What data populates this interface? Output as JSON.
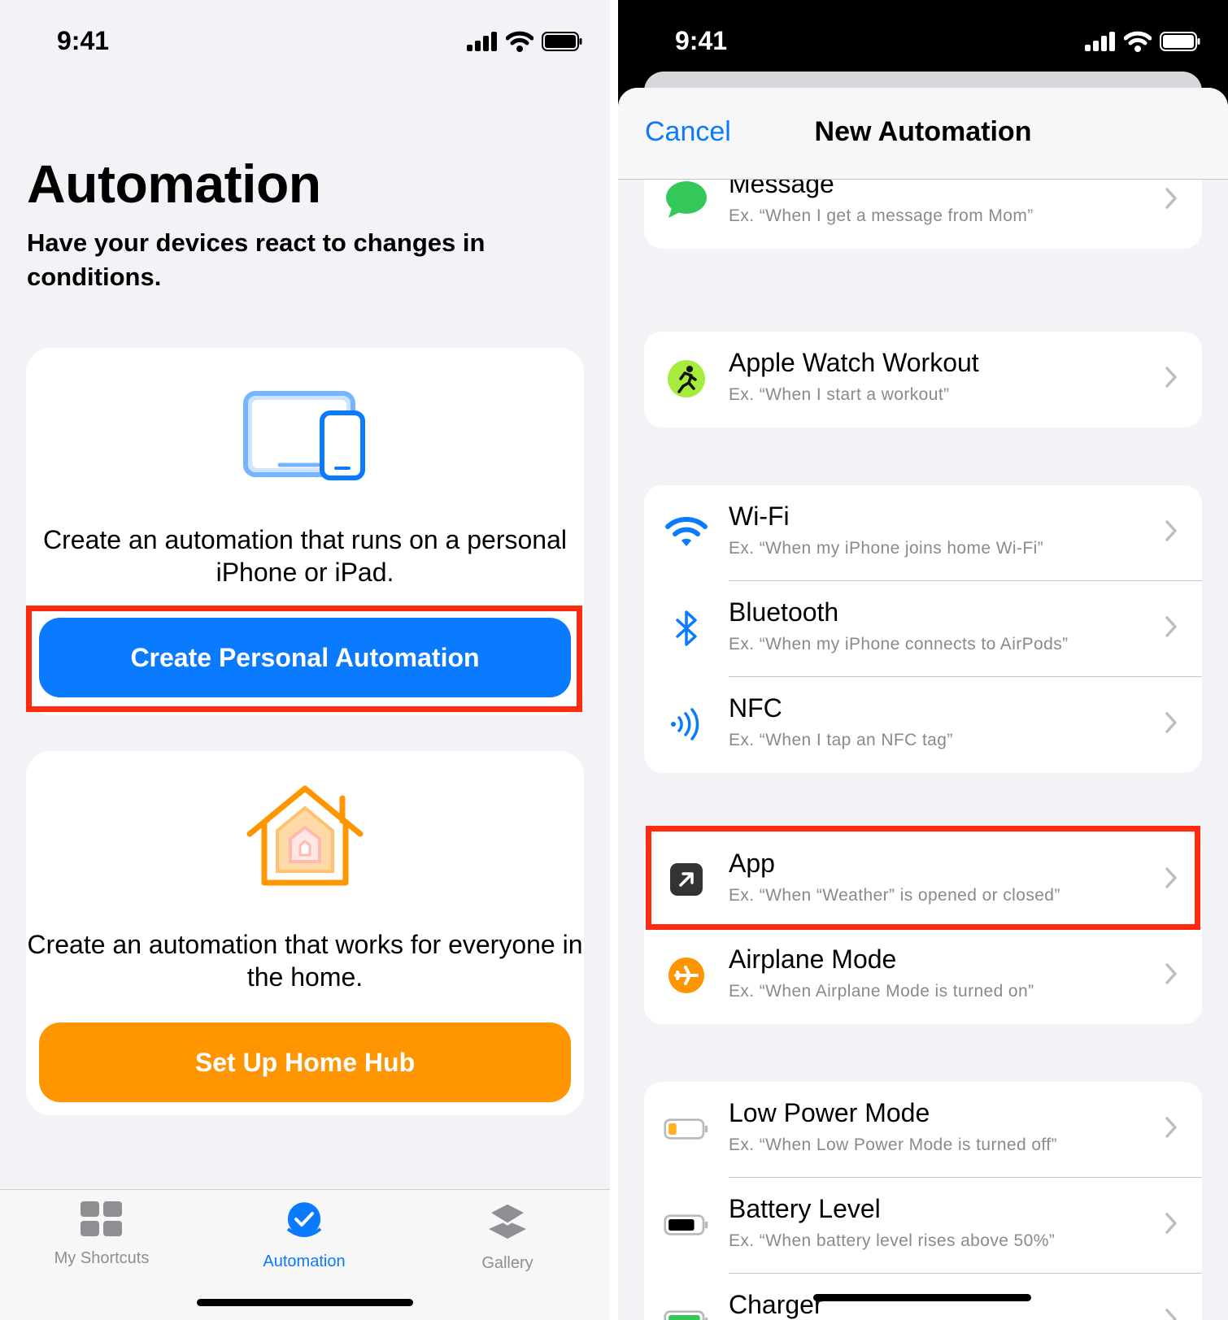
{
  "status_bar": {
    "time": "9:41"
  },
  "left": {
    "title": "Automation",
    "subtitle": "Have your devices react to changes in conditions.",
    "personal_card": {
      "icon": "devices-icon",
      "text": "Create an automation that runs on a personal iPhone or iPad.",
      "button_label": "Create Personal Automation",
      "button_color": "#0A7AFF"
    },
    "home_card": {
      "icon": "home-icon",
      "text": "Create an automation that works for everyone in the home.",
      "button_label": "Set Up Home Hub",
      "button_color": "#FF9500"
    },
    "tabs": [
      {
        "label": "My Shortcuts",
        "icon": "grid-icon",
        "active": false
      },
      {
        "label": "Automation",
        "icon": "checkmark-circle-icon",
        "active": true
      },
      {
        "label": "Gallery",
        "icon": "layers-icon",
        "active": false
      }
    ],
    "highlight_color": "#FF2A10"
  },
  "right": {
    "header": {
      "cancel_label": "Cancel",
      "title": "New Automation"
    },
    "groups": [
      {
        "rows": [
          {
            "title": "Message",
            "subtitle": "Ex. “When I get a message from Mom”",
            "icon": "message-bubble-icon"
          }
        ]
      },
      {
        "rows": [
          {
            "title": "Apple Watch Workout",
            "subtitle": "Ex. “When I start a workout”",
            "icon": "workout-runner-icon"
          }
        ]
      },
      {
        "rows": [
          {
            "title": "Wi-Fi",
            "subtitle": "Ex. “When my iPhone joins home Wi-Fi”",
            "icon": "wifi-icon"
          },
          {
            "title": "Bluetooth",
            "subtitle": "Ex. “When my iPhone connects to AirPods”",
            "icon": "bluetooth-icon"
          },
          {
            "title": "NFC",
            "subtitle": "Ex. “When I tap an NFC tag”",
            "icon": "nfc-icon"
          }
        ]
      },
      {
        "rows": [
          {
            "title": "App",
            "subtitle": "Ex. “When “Weather” is opened or closed”",
            "icon": "app-arrow-icon"
          },
          {
            "title": "Airplane Mode",
            "subtitle": "Ex. “When Airplane Mode is turned on”",
            "icon": "airplane-icon"
          }
        ]
      },
      {
        "rows": [
          {
            "title": "Low Power Mode",
            "subtitle": "Ex. “When Low Power Mode is turned off”",
            "icon": "low-power-battery-icon"
          },
          {
            "title": "Battery Level",
            "subtitle": "Ex. “When battery level rises above 50%”",
            "icon": "battery-icon"
          },
          {
            "title": "Charger",
            "subtitle": "",
            "icon": "charger-icon"
          }
        ]
      }
    ]
  }
}
